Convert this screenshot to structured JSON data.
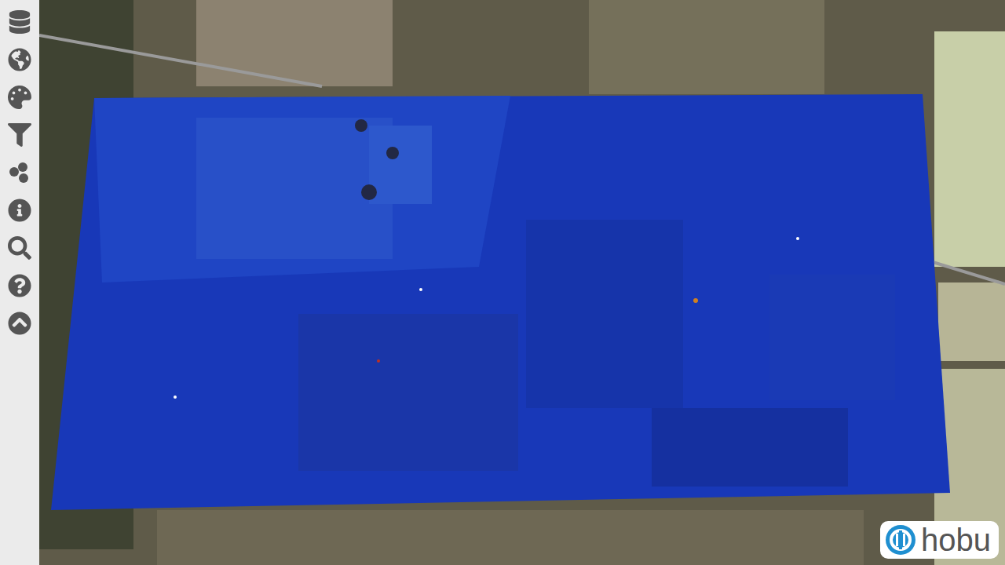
{
  "viewer": {
    "logo": "hobu"
  }
}
